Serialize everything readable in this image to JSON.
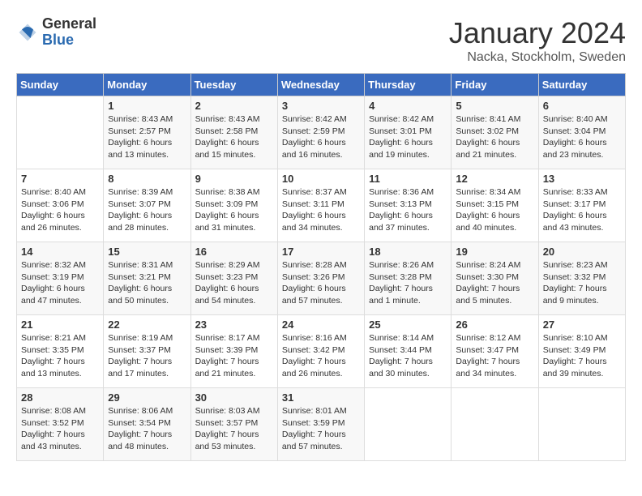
{
  "header": {
    "logo_general": "General",
    "logo_blue": "Blue",
    "month": "January 2024",
    "location": "Nacka, Stockholm, Sweden"
  },
  "days_of_week": [
    "Sunday",
    "Monday",
    "Tuesday",
    "Wednesday",
    "Thursday",
    "Friday",
    "Saturday"
  ],
  "weeks": [
    [
      {
        "num": "",
        "info": ""
      },
      {
        "num": "1",
        "info": "Sunrise: 8:43 AM\nSunset: 2:57 PM\nDaylight: 6 hours\nand 13 minutes."
      },
      {
        "num": "2",
        "info": "Sunrise: 8:43 AM\nSunset: 2:58 PM\nDaylight: 6 hours\nand 15 minutes."
      },
      {
        "num": "3",
        "info": "Sunrise: 8:42 AM\nSunset: 2:59 PM\nDaylight: 6 hours\nand 16 minutes."
      },
      {
        "num": "4",
        "info": "Sunrise: 8:42 AM\nSunset: 3:01 PM\nDaylight: 6 hours\nand 19 minutes."
      },
      {
        "num": "5",
        "info": "Sunrise: 8:41 AM\nSunset: 3:02 PM\nDaylight: 6 hours\nand 21 minutes."
      },
      {
        "num": "6",
        "info": "Sunrise: 8:40 AM\nSunset: 3:04 PM\nDaylight: 6 hours\nand 23 minutes."
      }
    ],
    [
      {
        "num": "7",
        "info": "Sunrise: 8:40 AM\nSunset: 3:06 PM\nDaylight: 6 hours\nand 26 minutes."
      },
      {
        "num": "8",
        "info": "Sunrise: 8:39 AM\nSunset: 3:07 PM\nDaylight: 6 hours\nand 28 minutes."
      },
      {
        "num": "9",
        "info": "Sunrise: 8:38 AM\nSunset: 3:09 PM\nDaylight: 6 hours\nand 31 minutes."
      },
      {
        "num": "10",
        "info": "Sunrise: 8:37 AM\nSunset: 3:11 PM\nDaylight: 6 hours\nand 34 minutes."
      },
      {
        "num": "11",
        "info": "Sunrise: 8:36 AM\nSunset: 3:13 PM\nDaylight: 6 hours\nand 37 minutes."
      },
      {
        "num": "12",
        "info": "Sunrise: 8:34 AM\nSunset: 3:15 PM\nDaylight: 6 hours\nand 40 minutes."
      },
      {
        "num": "13",
        "info": "Sunrise: 8:33 AM\nSunset: 3:17 PM\nDaylight: 6 hours\nand 43 minutes."
      }
    ],
    [
      {
        "num": "14",
        "info": "Sunrise: 8:32 AM\nSunset: 3:19 PM\nDaylight: 6 hours\nand 47 minutes."
      },
      {
        "num": "15",
        "info": "Sunrise: 8:31 AM\nSunset: 3:21 PM\nDaylight: 6 hours\nand 50 minutes."
      },
      {
        "num": "16",
        "info": "Sunrise: 8:29 AM\nSunset: 3:23 PM\nDaylight: 6 hours\nand 54 minutes."
      },
      {
        "num": "17",
        "info": "Sunrise: 8:28 AM\nSunset: 3:26 PM\nDaylight: 6 hours\nand 57 minutes."
      },
      {
        "num": "18",
        "info": "Sunrise: 8:26 AM\nSunset: 3:28 PM\nDaylight: 7 hours\nand 1 minute."
      },
      {
        "num": "19",
        "info": "Sunrise: 8:24 AM\nSunset: 3:30 PM\nDaylight: 7 hours\nand 5 minutes."
      },
      {
        "num": "20",
        "info": "Sunrise: 8:23 AM\nSunset: 3:32 PM\nDaylight: 7 hours\nand 9 minutes."
      }
    ],
    [
      {
        "num": "21",
        "info": "Sunrise: 8:21 AM\nSunset: 3:35 PM\nDaylight: 7 hours\nand 13 minutes."
      },
      {
        "num": "22",
        "info": "Sunrise: 8:19 AM\nSunset: 3:37 PM\nDaylight: 7 hours\nand 17 minutes."
      },
      {
        "num": "23",
        "info": "Sunrise: 8:17 AM\nSunset: 3:39 PM\nDaylight: 7 hours\nand 21 minutes."
      },
      {
        "num": "24",
        "info": "Sunrise: 8:16 AM\nSunset: 3:42 PM\nDaylight: 7 hours\nand 26 minutes."
      },
      {
        "num": "25",
        "info": "Sunrise: 8:14 AM\nSunset: 3:44 PM\nDaylight: 7 hours\nand 30 minutes."
      },
      {
        "num": "26",
        "info": "Sunrise: 8:12 AM\nSunset: 3:47 PM\nDaylight: 7 hours\nand 34 minutes."
      },
      {
        "num": "27",
        "info": "Sunrise: 8:10 AM\nSunset: 3:49 PM\nDaylight: 7 hours\nand 39 minutes."
      }
    ],
    [
      {
        "num": "28",
        "info": "Sunrise: 8:08 AM\nSunset: 3:52 PM\nDaylight: 7 hours\nand 43 minutes."
      },
      {
        "num": "29",
        "info": "Sunrise: 8:06 AM\nSunset: 3:54 PM\nDaylight: 7 hours\nand 48 minutes."
      },
      {
        "num": "30",
        "info": "Sunrise: 8:03 AM\nSunset: 3:57 PM\nDaylight: 7 hours\nand 53 minutes."
      },
      {
        "num": "31",
        "info": "Sunrise: 8:01 AM\nSunset: 3:59 PM\nDaylight: 7 hours\nand 57 minutes."
      },
      {
        "num": "",
        "info": ""
      },
      {
        "num": "",
        "info": ""
      },
      {
        "num": "",
        "info": ""
      }
    ]
  ]
}
